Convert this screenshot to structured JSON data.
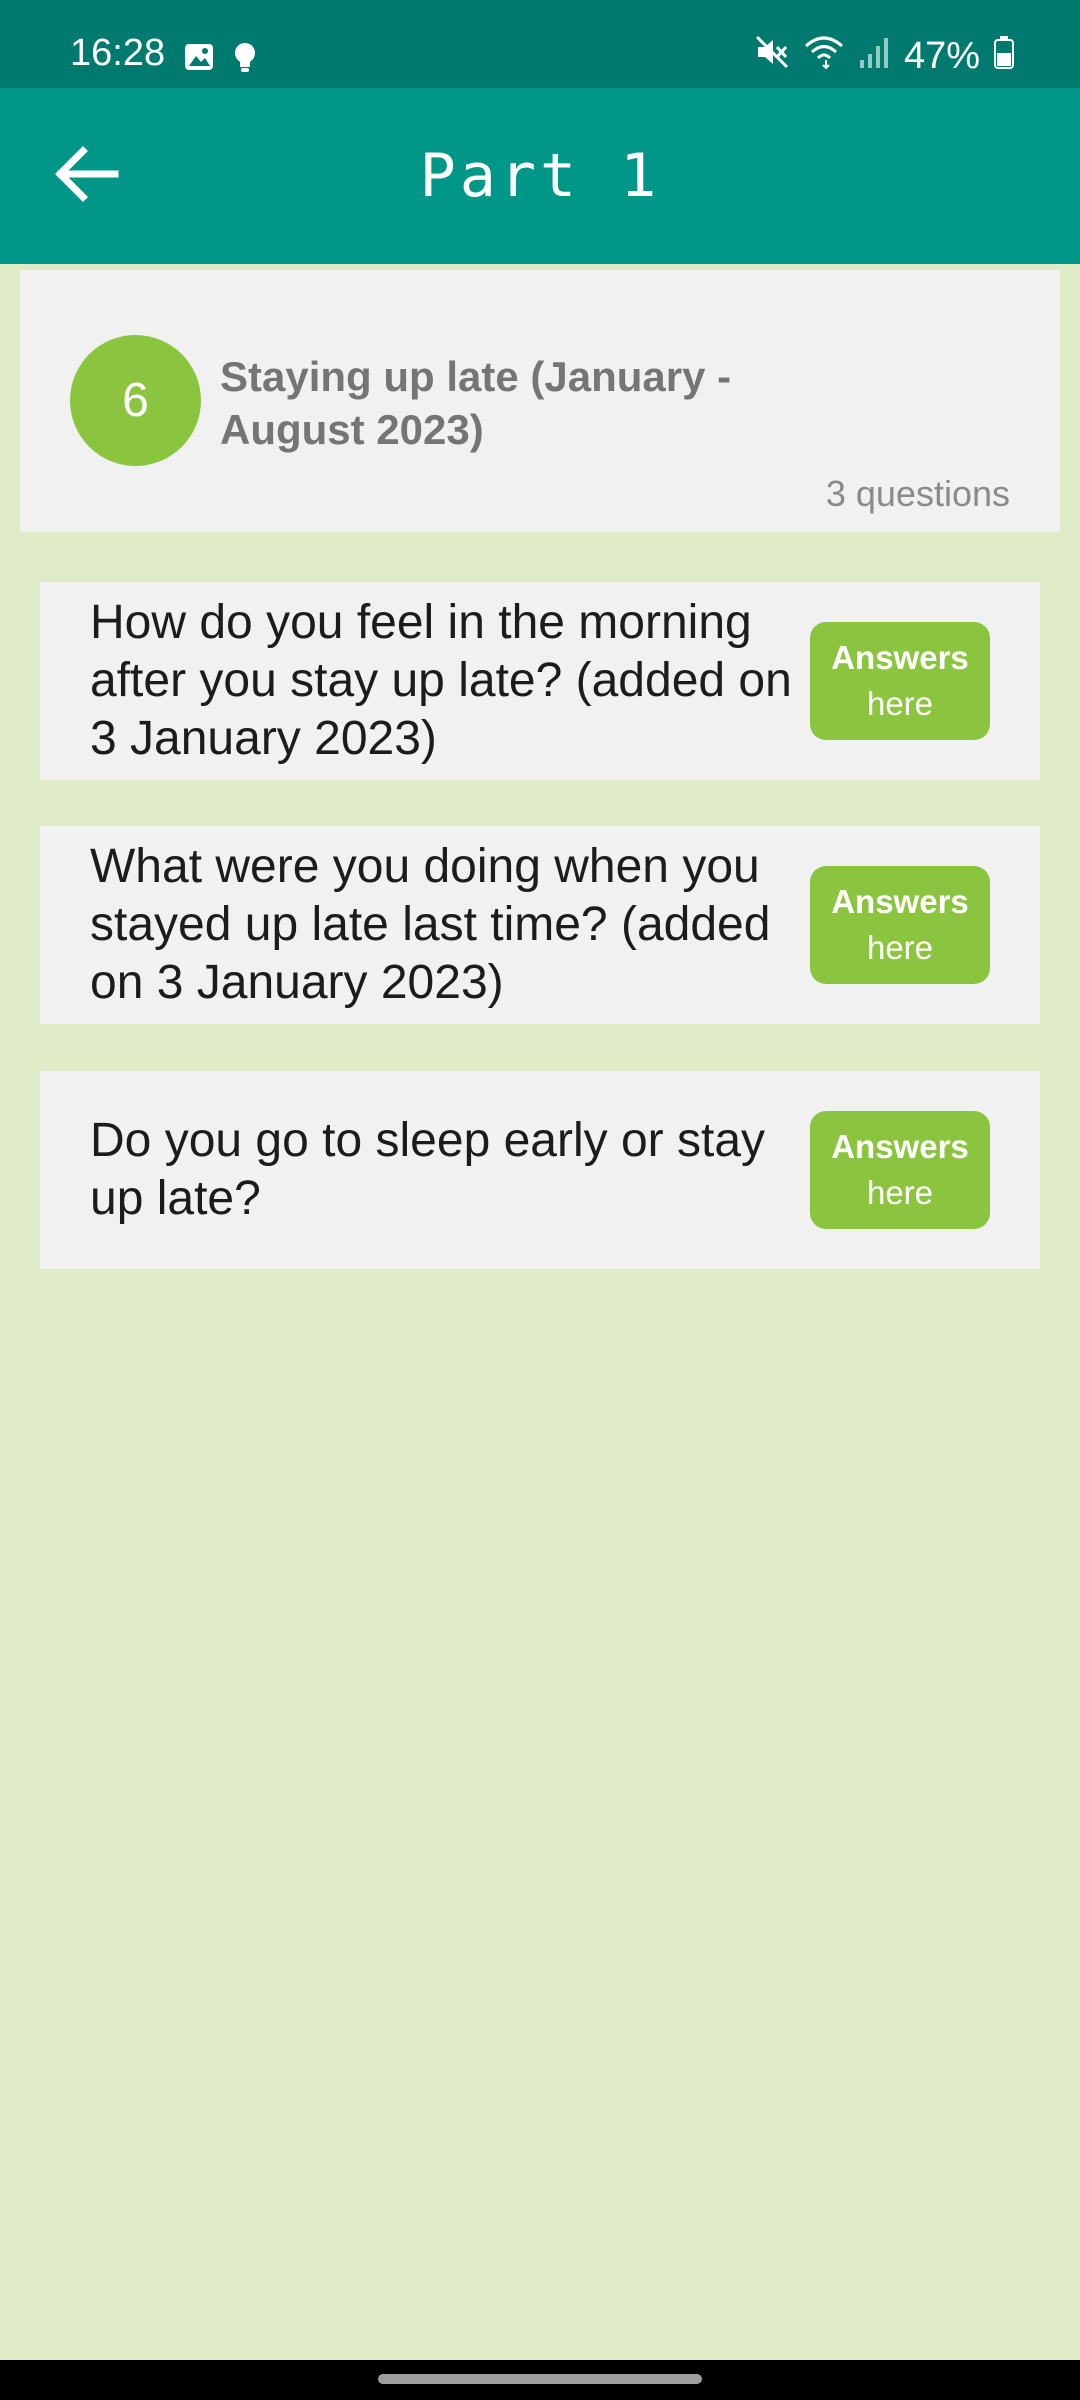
{
  "status_bar": {
    "time": "16:28",
    "battery": "47%",
    "icons": [
      "gallery-icon",
      "bulb-icon",
      "mute-icon",
      "wifi-icon",
      "signal-icon",
      "battery-icon"
    ]
  },
  "app_bar": {
    "title": "Part 1",
    "back_icon": "arrow-left-icon"
  },
  "header": {
    "number": "6",
    "title": "Staying up late (January - August 2023)",
    "count": "3 questions"
  },
  "questions": [
    {
      "text": "How do you feel in the morning after you stay up late? (added on 3 January 2023)",
      "button_line1": "Answers",
      "button_line2": "here"
    },
    {
      "text": "What were you doing when you stayed up late last time? (added on 3 January 2023)",
      "button_line1": "Answers",
      "button_line2": "here"
    },
    {
      "text": "Do you go to sleep early or stay up late?",
      "button_line1": "Answers",
      "button_line2": "here"
    }
  ],
  "colors": {
    "status_bar": "#007a6e",
    "app_bar": "#009688",
    "background": "#dfebc6",
    "card": "#f1f1f1",
    "accent_green": "#8bc540"
  }
}
